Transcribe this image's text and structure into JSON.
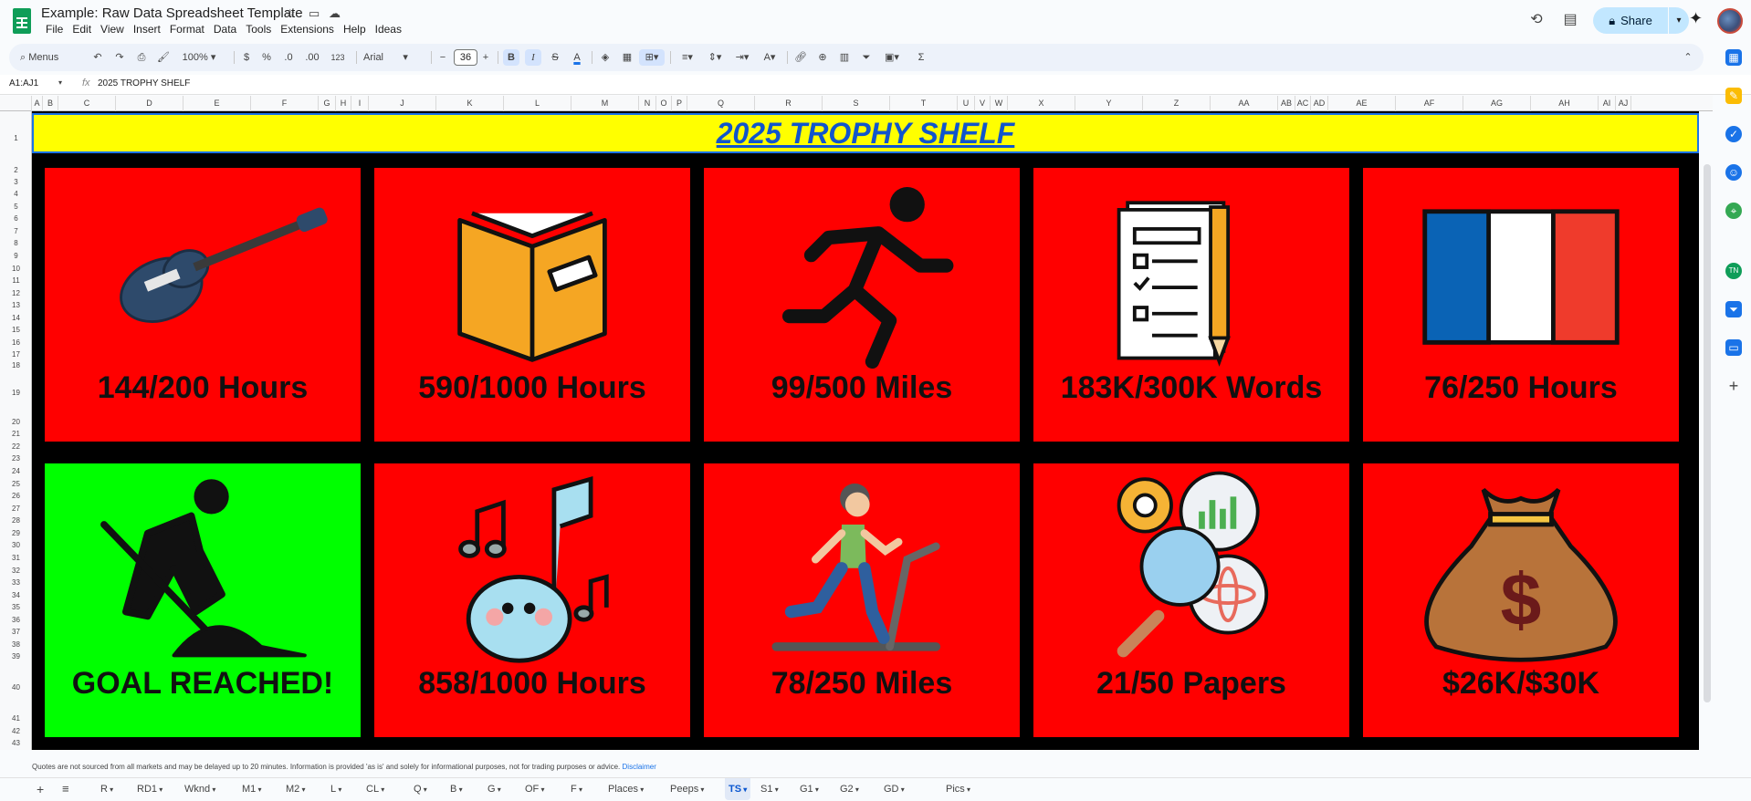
{
  "app": {
    "doc_title": "Example: Raw Data Spreadsheet Template",
    "menu": [
      "File",
      "Edit",
      "View",
      "Insert",
      "Format",
      "Data",
      "Tools",
      "Extensions",
      "Help",
      "Ideas"
    ],
    "share_label": "Share"
  },
  "toolbar": {
    "menus_label": "Menus",
    "zoom": "100%",
    "currency": "$",
    "percent": "%",
    "dec_less": ".0",
    "dec_more": ".00",
    "number_format": "123",
    "font": "Arial",
    "font_size": "36"
  },
  "formula_bar": {
    "name_box": "A1:AJ1",
    "fx": "fx",
    "content": "2025 TROPHY SHELF"
  },
  "columns": [
    "A",
    "B",
    "C",
    "D",
    "E",
    "F",
    "G",
    "H",
    "I",
    "J",
    "K",
    "L",
    "M",
    "N",
    "O",
    "P",
    "Q",
    "R",
    "S",
    "T",
    "U",
    "V",
    "W",
    "X",
    "Y",
    "Z",
    "AA",
    "AB",
    "AC",
    "AD",
    "AE",
    "AF",
    "AG",
    "AH",
    "AI",
    "AJ"
  ],
  "rows": [
    "1",
    "2",
    "3",
    "4",
    "5",
    "6",
    "7",
    "8",
    "9",
    "10",
    "11",
    "12",
    "13",
    "14",
    "15",
    "16",
    "17",
    "18",
    "19",
    "20",
    "21",
    "22",
    "23",
    "24",
    "25",
    "26",
    "27",
    "28",
    "29",
    "30",
    "31",
    "32",
    "33",
    "34",
    "35",
    "36",
    "37",
    "38",
    "39",
    "40",
    "41",
    "42",
    "43"
  ],
  "banner": "2025 TROPHY SHELF",
  "tiles": [
    {
      "icon": "guitar-icon",
      "caption": "144/200 Hours",
      "status": "red"
    },
    {
      "icon": "book-icon",
      "caption": "590/1000 Hours",
      "status": "red"
    },
    {
      "icon": "runner-icon",
      "caption": "99/500 Miles",
      "status": "red"
    },
    {
      "icon": "checklist-icon",
      "caption": "183K/300K Words",
      "status": "red"
    },
    {
      "icon": "french-flag-icon",
      "caption": "76/250 Hours",
      "status": "red"
    },
    {
      "icon": "digging-worker-icon",
      "caption": "GOAL REACHED!",
      "status": "green"
    },
    {
      "icon": "music-note-icon",
      "caption": "858/1000 Hours",
      "status": "red"
    },
    {
      "icon": "treadmill-icon",
      "caption": "78/250 Miles",
      "status": "red"
    },
    {
      "icon": "research-icon",
      "caption": "21/50 Papers",
      "status": "red"
    },
    {
      "icon": "money-bag-icon",
      "caption": "$26K/$30K",
      "status": "red"
    }
  ],
  "colors": {
    "behind": "#ff0000",
    "reached": "#00ff00",
    "banner_bg": "#ffff00",
    "banner_text": "#1155cc"
  },
  "disclaimer": {
    "text": "Quotes are not sourced from all markets and may be delayed up to 20 minutes. Information is provided 'as is' and solely for informational purposes, not for trading purposes or advice.",
    "link": "Disclaimer"
  },
  "sheet_tabs": [
    "R",
    "RD1",
    "Wknd",
    "M1",
    "M2",
    "L",
    "CL",
    "Q",
    "B",
    "G",
    "OF",
    "F",
    "Places",
    "Peeps",
    "TS",
    "S1",
    "G1",
    "G2",
    "GD",
    "Pics"
  ],
  "active_tab": "TS"
}
